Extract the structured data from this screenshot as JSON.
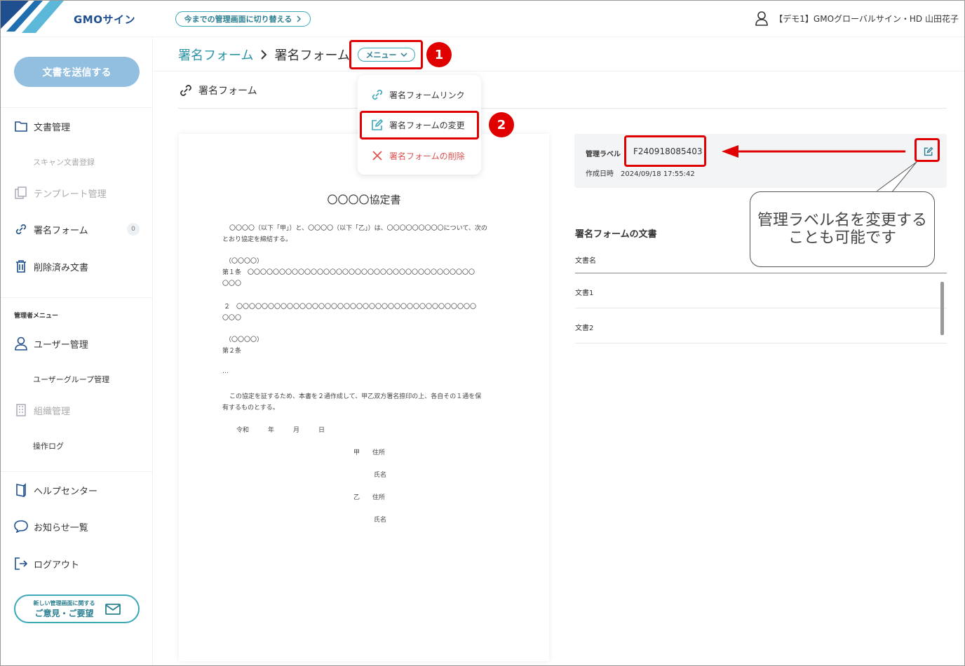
{
  "header": {
    "logo_text": "GMOサイン",
    "switch_label": "今までの管理画面に切り替える",
    "user_name": "【デモ1】GMOグローバルサイン・HD 山田花子"
  },
  "sidebar": {
    "send_button": "文書を送信する",
    "items": [
      {
        "label": "文書管理"
      },
      {
        "label": "スキャン文書登録"
      },
      {
        "label": "テンプレート管理"
      },
      {
        "label": "署名フォーム",
        "badge": "0"
      },
      {
        "label": "削除済み文書"
      }
    ],
    "admin_label": "管理者メニュー",
    "admin_items": [
      {
        "label": "ユーザー管理"
      },
      {
        "label": "ユーザーグループ管理"
      },
      {
        "label": "組織管理"
      },
      {
        "label": "操作ログ"
      }
    ],
    "footer_items": [
      {
        "label": "ヘルプセンター"
      },
      {
        "label": "お知らせ一覧"
      },
      {
        "label": "ログアウト"
      }
    ],
    "feedback": {
      "line1": "新しい管理画面に関する",
      "line2": "ご意見・ご要望"
    }
  },
  "breadcrumb": {
    "parent": "署名フォーム",
    "current": "署名フォーム",
    "menu_label": "メニュー"
  },
  "sub_title": "署名フォーム",
  "dropdown": {
    "items": [
      {
        "label": "署名フォームリンク"
      },
      {
        "label": "署名フォームの変更"
      },
      {
        "label": "署名フォームの削除"
      }
    ]
  },
  "annotations": {
    "step1": "1",
    "step2": "2",
    "callout": "管理ラベル名を変更することも可能です"
  },
  "document": {
    "title": "〇〇〇〇協定書",
    "lines": [
      "〇〇〇〇（以下「甲」）と、〇〇〇〇（以下「乙」）は、〇〇〇〇〇〇〇〇〇について、次の",
      "とおり協定を締結する。",
      "（〇〇〇〇）",
      "第１条　〇〇〇〇〇〇〇〇〇〇〇〇〇〇〇〇〇〇〇〇〇〇〇〇〇〇〇〇〇〇〇〇〇〇〇〇",
      "〇〇〇",
      "２　〇〇〇〇〇〇〇〇〇〇〇〇〇〇〇〇〇〇〇〇〇〇〇〇〇〇〇〇〇〇〇〇〇〇〇〇〇〇",
      "〇〇〇",
      "（〇〇〇〇）",
      "第２条",
      "…",
      "この協定を証するため、本書を２通作成して、甲乙双方署名捺印の上、各自その１通を保",
      "有するものとする。",
      "令和　　　年　　　月　　　日",
      "甲　　住所",
      "氏名",
      "乙　　住所",
      "氏名"
    ]
  },
  "info": {
    "label_key": "管理ラベル",
    "label_value": "F240918085403",
    "created": "作成日時　2024/09/18 17:55:42"
  },
  "documents_section": {
    "title": "署名フォームの文書",
    "column": "文書名",
    "rows": [
      "文書1",
      "文書2"
    ]
  },
  "colors": {
    "accent": "#3aa8b8",
    "highlight": "#e00000",
    "send_button": "#92bedf"
  }
}
